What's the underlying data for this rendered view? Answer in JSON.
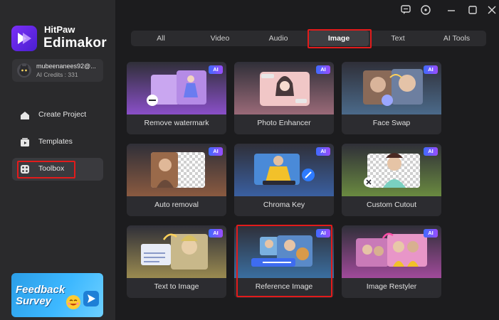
{
  "app": {
    "brand_line1": "HitPaw",
    "brand_line2": "Edimakor"
  },
  "user": {
    "name": "mubeenanees92@...",
    "credits": "AI Credits : 331"
  },
  "sidebar": {
    "items": [
      {
        "label": "Create Project",
        "icon": "house-icon"
      },
      {
        "label": "Templates",
        "icon": "templates-icon"
      },
      {
        "label": "Toolbox",
        "icon": "toolbox-icon",
        "active": true
      }
    ]
  },
  "feedback": {
    "line1": "Feedback",
    "line2": "Survey"
  },
  "tabs": [
    {
      "label": "All"
    },
    {
      "label": "Video"
    },
    {
      "label": "Audio"
    },
    {
      "label": "Image",
      "active": true
    },
    {
      "label": "Text"
    },
    {
      "label": "AI Tools"
    }
  ],
  "cards": [
    {
      "title": "Remove watermark",
      "badge": "AI"
    },
    {
      "title": "Photo Enhancer",
      "badge": "AI"
    },
    {
      "title": "Face Swap",
      "badge": "AI"
    },
    {
      "title": "Auto removal",
      "badge": "AI"
    },
    {
      "title": "Chroma Key",
      "badge": "AI"
    },
    {
      "title": "Custom Cutout",
      "badge": "AI"
    },
    {
      "title": "Text to Image",
      "badge": "AI"
    },
    {
      "title": "Reference Image",
      "badge": "AI"
    },
    {
      "title": "Image Restyler",
      "badge": "AI"
    }
  ],
  "colors": {
    "accent": "#7b2ff7",
    "highlight": "#e21b1b",
    "background": "#1c1c1e",
    "sidebar": "#2a2a2c"
  }
}
